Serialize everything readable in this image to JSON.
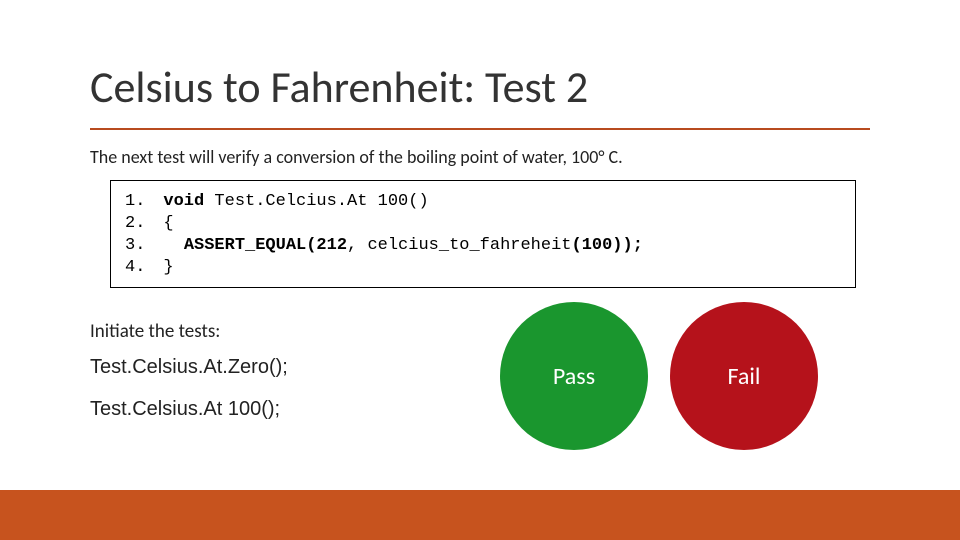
{
  "title": "Celsius to Fahrenheit: Test 2",
  "subtitle": "The next test will verify a conversion of the boiling point of water, 100° C.",
  "code": {
    "line_numbers": [
      "1.",
      "2.",
      "3.",
      "4."
    ],
    "lines": {
      "l1_kw": "void",
      "l1_rest": " Test.Celcius.At 100()",
      "l2": "{",
      "l3_indent": "  ",
      "l3_fn": "ASSERT_EQUAL(212",
      "l3_mid": ", celcius_to_fahreheit",
      "l3_arg_open": "(",
      "l3_arg_num": "100",
      "l3_arg_close": "));",
      "l4": "}"
    }
  },
  "initiate_label": "Initiate the tests:",
  "calls": {
    "call1": "Test.Celsius.At.Zero();",
    "call2": "Test.Celsius.At 100();"
  },
  "pass_label": "Pass",
  "fail_label": "Fail",
  "colors": {
    "accent_rule": "#b84b1f",
    "bottom_bar": "#c7531e",
    "pass": "#1a962e",
    "fail": "#b5121b"
  }
}
